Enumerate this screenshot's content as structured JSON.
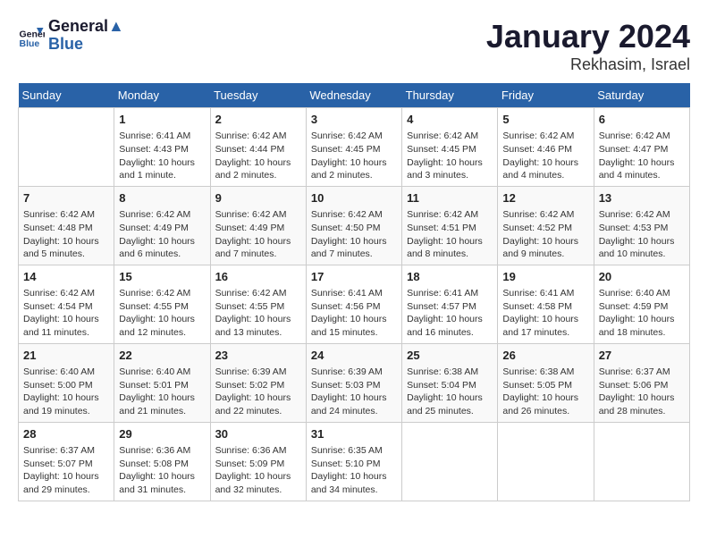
{
  "header": {
    "logo_line1": "General",
    "logo_line2": "Blue",
    "month": "January 2024",
    "location": "Rekhasim, Israel"
  },
  "weekdays": [
    "Sunday",
    "Monday",
    "Tuesday",
    "Wednesday",
    "Thursday",
    "Friday",
    "Saturday"
  ],
  "weeks": [
    [
      {
        "day": "",
        "info": ""
      },
      {
        "day": "1",
        "info": "Sunrise: 6:41 AM\nSunset: 4:43 PM\nDaylight: 10 hours\nand 1 minute."
      },
      {
        "day": "2",
        "info": "Sunrise: 6:42 AM\nSunset: 4:44 PM\nDaylight: 10 hours\nand 2 minutes."
      },
      {
        "day": "3",
        "info": "Sunrise: 6:42 AM\nSunset: 4:45 PM\nDaylight: 10 hours\nand 2 minutes."
      },
      {
        "day": "4",
        "info": "Sunrise: 6:42 AM\nSunset: 4:45 PM\nDaylight: 10 hours\nand 3 minutes."
      },
      {
        "day": "5",
        "info": "Sunrise: 6:42 AM\nSunset: 4:46 PM\nDaylight: 10 hours\nand 4 minutes."
      },
      {
        "day": "6",
        "info": "Sunrise: 6:42 AM\nSunset: 4:47 PM\nDaylight: 10 hours\nand 4 minutes."
      }
    ],
    [
      {
        "day": "7",
        "info": "Sunrise: 6:42 AM\nSunset: 4:48 PM\nDaylight: 10 hours\nand 5 minutes."
      },
      {
        "day": "8",
        "info": "Sunrise: 6:42 AM\nSunset: 4:49 PM\nDaylight: 10 hours\nand 6 minutes."
      },
      {
        "day": "9",
        "info": "Sunrise: 6:42 AM\nSunset: 4:49 PM\nDaylight: 10 hours\nand 7 minutes."
      },
      {
        "day": "10",
        "info": "Sunrise: 6:42 AM\nSunset: 4:50 PM\nDaylight: 10 hours\nand 7 minutes."
      },
      {
        "day": "11",
        "info": "Sunrise: 6:42 AM\nSunset: 4:51 PM\nDaylight: 10 hours\nand 8 minutes."
      },
      {
        "day": "12",
        "info": "Sunrise: 6:42 AM\nSunset: 4:52 PM\nDaylight: 10 hours\nand 9 minutes."
      },
      {
        "day": "13",
        "info": "Sunrise: 6:42 AM\nSunset: 4:53 PM\nDaylight: 10 hours\nand 10 minutes."
      }
    ],
    [
      {
        "day": "14",
        "info": "Sunrise: 6:42 AM\nSunset: 4:54 PM\nDaylight: 10 hours\nand 11 minutes."
      },
      {
        "day": "15",
        "info": "Sunrise: 6:42 AM\nSunset: 4:55 PM\nDaylight: 10 hours\nand 12 minutes."
      },
      {
        "day": "16",
        "info": "Sunrise: 6:42 AM\nSunset: 4:55 PM\nDaylight: 10 hours\nand 13 minutes."
      },
      {
        "day": "17",
        "info": "Sunrise: 6:41 AM\nSunset: 4:56 PM\nDaylight: 10 hours\nand 15 minutes."
      },
      {
        "day": "18",
        "info": "Sunrise: 6:41 AM\nSunset: 4:57 PM\nDaylight: 10 hours\nand 16 minutes."
      },
      {
        "day": "19",
        "info": "Sunrise: 6:41 AM\nSunset: 4:58 PM\nDaylight: 10 hours\nand 17 minutes."
      },
      {
        "day": "20",
        "info": "Sunrise: 6:40 AM\nSunset: 4:59 PM\nDaylight: 10 hours\nand 18 minutes."
      }
    ],
    [
      {
        "day": "21",
        "info": "Sunrise: 6:40 AM\nSunset: 5:00 PM\nDaylight: 10 hours\nand 19 minutes."
      },
      {
        "day": "22",
        "info": "Sunrise: 6:40 AM\nSunset: 5:01 PM\nDaylight: 10 hours\nand 21 minutes."
      },
      {
        "day": "23",
        "info": "Sunrise: 6:39 AM\nSunset: 5:02 PM\nDaylight: 10 hours\nand 22 minutes."
      },
      {
        "day": "24",
        "info": "Sunrise: 6:39 AM\nSunset: 5:03 PM\nDaylight: 10 hours\nand 24 minutes."
      },
      {
        "day": "25",
        "info": "Sunrise: 6:38 AM\nSunset: 5:04 PM\nDaylight: 10 hours\nand 25 minutes."
      },
      {
        "day": "26",
        "info": "Sunrise: 6:38 AM\nSunset: 5:05 PM\nDaylight: 10 hours\nand 26 minutes."
      },
      {
        "day": "27",
        "info": "Sunrise: 6:37 AM\nSunset: 5:06 PM\nDaylight: 10 hours\nand 28 minutes."
      }
    ],
    [
      {
        "day": "28",
        "info": "Sunrise: 6:37 AM\nSunset: 5:07 PM\nDaylight: 10 hours\nand 29 minutes."
      },
      {
        "day": "29",
        "info": "Sunrise: 6:36 AM\nSunset: 5:08 PM\nDaylight: 10 hours\nand 31 minutes."
      },
      {
        "day": "30",
        "info": "Sunrise: 6:36 AM\nSunset: 5:09 PM\nDaylight: 10 hours\nand 32 minutes."
      },
      {
        "day": "31",
        "info": "Sunrise: 6:35 AM\nSunset: 5:10 PM\nDaylight: 10 hours\nand 34 minutes."
      },
      {
        "day": "",
        "info": ""
      },
      {
        "day": "",
        "info": ""
      },
      {
        "day": "",
        "info": ""
      }
    ]
  ]
}
